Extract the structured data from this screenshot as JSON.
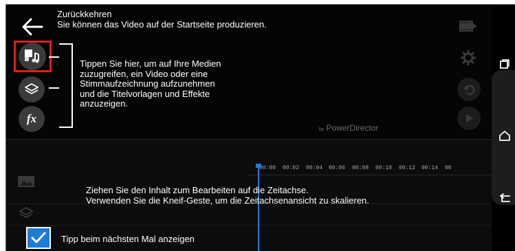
{
  "tips": {
    "back_title": "Zurückkehren",
    "back_desc": "Sie können das Video auf der Startseite produzieren.",
    "media_lines": [
      "Tippen Sie hier, um auf Ihre Medien",
      "zuzugreifen, ein Video oder eine",
      "Stimmaufzeichnung aufzunehmen",
      "und die Titelvorlagen und Effekte",
      "anzuzeigen."
    ],
    "timeline_line1": "Ziehen Sie den Inhalt zum Bearbeiten auf die Zeitachse.",
    "timeline_line2": "Verwenden Sie die Kneif-Geste, um die Zeitachsenansicht zu skalieren.",
    "show_next_label": "Tipp beim nächsten Mal anzeigen"
  },
  "left_toolbar": {
    "effects_label": "fx"
  },
  "branding": {
    "prefix": "by",
    "name": "PowerDirector"
  },
  "timeline": {
    "ruler_labels": [
      "00:00",
      "00:02",
      "00:04",
      "00:06",
      "00:08",
      "00:10",
      "00:12",
      "00:14",
      "00"
    ]
  },
  "checkbox": {
    "checked": true
  },
  "icons": {
    "back": "arrow-left-icon",
    "media": "media-library-icon",
    "layers": "layers-icon",
    "effects": "fx-icon",
    "produce": "film-export-icon",
    "settings": "gear-icon",
    "undo": "undo-icon",
    "play": "play-icon",
    "recent_apps": "recent-apps-icon",
    "home": "home-icon",
    "back_nav": "back-nav-icon"
  },
  "colors": {
    "accent": "#1f7bd6",
    "highlight": "#e21d1d",
    "button_bg": "#3b3b3b"
  }
}
